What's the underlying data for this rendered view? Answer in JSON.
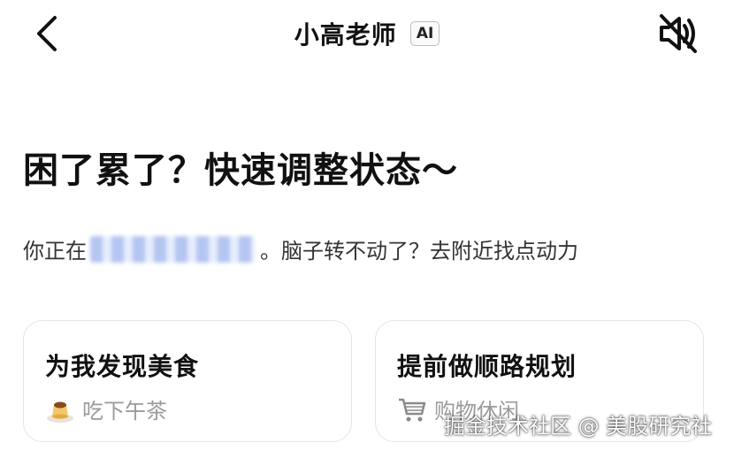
{
  "header": {
    "title": "小高老师",
    "badge": "AI",
    "back_icon": "chevron-left-icon",
    "mute_icon": "speaker-muted-icon"
  },
  "main": {
    "headline": "困了累了？快速调整状态～",
    "sub_prefix": "你正在",
    "sub_suffix": "。脑子转不动了？去附近找点动力"
  },
  "cards": [
    {
      "title": "为我发现美食",
      "subtitle": "吃下午茶",
      "icon": "pudding-icon"
    },
    {
      "title": "提前做顺路规划",
      "subtitle": "购物休闲",
      "icon": "shopping-cart-icon"
    }
  ],
  "watermark": "掘金技术社区 @ 美股研究社"
}
